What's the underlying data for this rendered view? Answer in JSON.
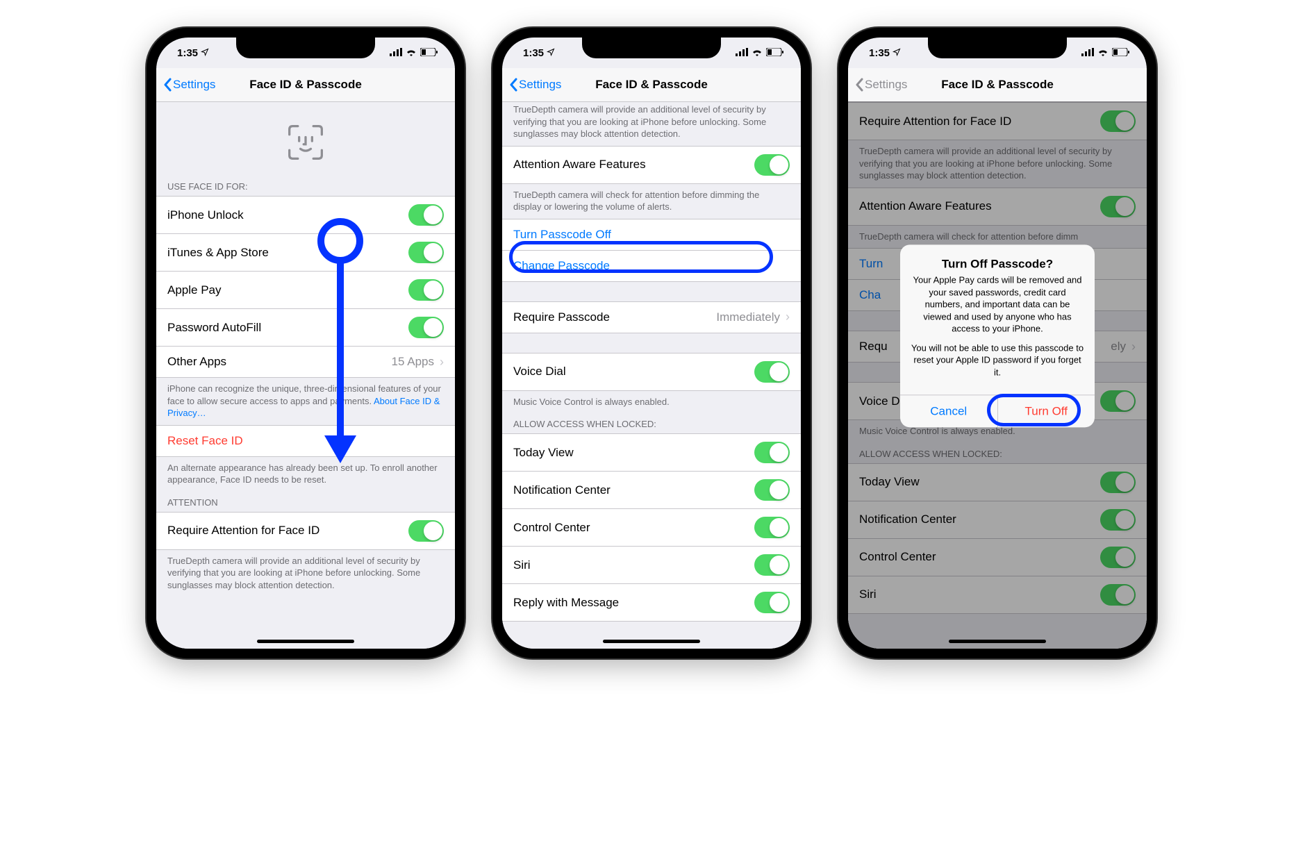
{
  "status": {
    "time": "1:35",
    "loc_icon": "↗"
  },
  "nav": {
    "back": "Settings",
    "title": "Face ID & Passcode"
  },
  "screen1": {
    "section_use": "USE FACE ID FOR:",
    "items": [
      {
        "label": "iPhone Unlock"
      },
      {
        "label": "iTunes & App Store"
      },
      {
        "label": "Apple Pay"
      },
      {
        "label": "Password AutoFill"
      }
    ],
    "other_apps": {
      "label": "Other Apps",
      "detail": "15 Apps"
    },
    "footer_use": "iPhone can recognize the unique, three-dimensional features of your face to allow secure access to apps and payments. ",
    "footer_use_link": "About Face ID & Privacy…",
    "reset": "Reset Face ID",
    "reset_footer": "An alternate appearance has already been set up. To enroll another appearance, Face ID needs to be reset.",
    "attention_header": "ATTENTION",
    "require_attention": "Require Attention for Face ID",
    "attention_footer": "TrueDepth camera will provide an additional level of security by verifying that you are looking at iPhone before unlocking. Some sunglasses may block attention detection."
  },
  "screen2": {
    "truncated_top": "TrueDepth camera will provide an additional level of security by verifying that you are looking at iPhone before unlocking. Some sunglasses may block attention detection.",
    "aaf": "Attention Aware Features",
    "aaf_footer": "TrueDepth camera will check for attention before dimming the display or lowering the volume of alerts.",
    "turn_off": "Turn Passcode Off",
    "change": "Change Passcode",
    "require": "Require Passcode",
    "require_detail": "Immediately",
    "voice_dial": "Voice Dial",
    "voice_footer": "Music Voice Control is always enabled.",
    "allow_header": "ALLOW ACCESS WHEN LOCKED:",
    "allow_items": [
      "Today View",
      "Notification Center",
      "Control Center",
      "Siri",
      "Reply with Message"
    ]
  },
  "screen3": {
    "req_att": "Require Attention for Face ID",
    "req_att_footer": "TrueDepth camera will provide an additional level of security by verifying that you are looking at iPhone before unlocking. Some sunglasses may block attention detection.",
    "aaf": "Attention Aware Features",
    "aaf_footer_trunc": "TrueDepth camera will check for attention before dimm",
    "turn_prefix": "Turn",
    "cha_prefix": "Cha",
    "require": "Requ",
    "require_detail": "ely",
    "voice": "Voice Dial",
    "voice_footer": "Music Voice Control is always enabled.",
    "allow_header": "ALLOW ACCESS WHEN LOCKED:",
    "allow_items": [
      "Today View",
      "Notification Center",
      "Control Center",
      "Siri"
    ],
    "alert": {
      "title": "Turn Off Passcode?",
      "msg1": "Your Apple Pay cards will be removed and your saved passwords, credit card numbers, and important data can be viewed and used by anyone who has access to your iPhone.",
      "msg2": "You will not be able to use this passcode to reset your Apple ID password if you forget it.",
      "cancel": "Cancel",
      "turn_off": "Turn Off"
    }
  }
}
